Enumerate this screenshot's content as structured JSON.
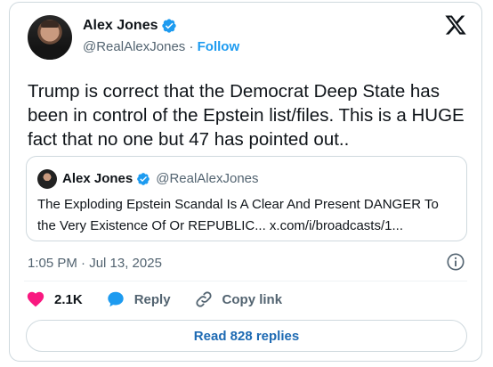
{
  "author": {
    "name": "Alex Jones",
    "handle": "@RealAlexJones",
    "separator": "·",
    "follow_label": "Follow"
  },
  "tweet": {
    "text": "Trump is correct that the Democrat Deep State has been in control of the Epstein list/files. This is a HUGE fact that no one but 47 has pointed out.."
  },
  "quote": {
    "name": "Alex Jones",
    "handle": "@RealAlexJones",
    "text": "The Exploding Epstein Scandal Is A Clear And Present DANGER To the Very Existence Of Or REPUBLIC...  x.com/i/broadcasts/1..."
  },
  "meta": {
    "timestamp": "1:05 PM · Jul 13, 2025"
  },
  "actions": {
    "likes": "2.1K",
    "reply_label": "Reply",
    "copy_label": "Copy link"
  },
  "read_replies_label": "Read 828 replies",
  "colors": {
    "accent": "#1d9bf0",
    "like": "#f91880",
    "muted": "#536471",
    "border": "#cfd9de"
  },
  "icons": [
    "verified-badge-icon",
    "x-logo-icon",
    "info-icon",
    "heart-icon",
    "reply-bubble-icon",
    "link-icon"
  ]
}
